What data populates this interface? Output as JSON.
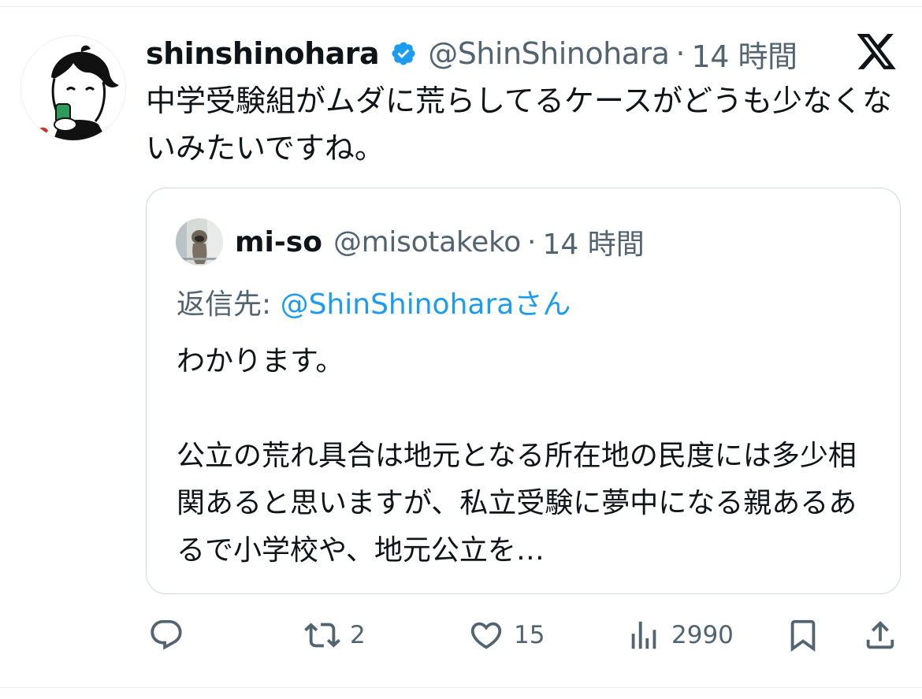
{
  "tweet": {
    "display_name": "shinshinohara",
    "verified": true,
    "handle": "@ShinShinohara",
    "separator": "·",
    "time": "14 時間",
    "text": "中学受験組がムダに荒らしてるケースがどうも少なくないみたいですね。"
  },
  "quote": {
    "display_name": "mi-so",
    "handle": "@misotakeko",
    "separator": "·",
    "time": "14 時間",
    "reply_prefix": "返信先: ",
    "reply_mention": "@ShinShinohara",
    "reply_suffix": "さん",
    "paragraph_1": "わかります。",
    "paragraph_2": "公立の荒れ具合は地元となる所在地の民度には多少相関あると思いますが、私立受験に夢中になる親あるあるで小学校や、地元公立を…"
  },
  "actions": {
    "reply_count": "",
    "retweet_count": "2",
    "like_count": "15",
    "views_count": "2990"
  },
  "icons": {
    "platform": "x-logo-icon",
    "verified": "verified-badge-icon",
    "reply": "reply-icon",
    "retweet": "retweet-icon",
    "like": "heart-icon",
    "views": "views-icon",
    "bookmark": "bookmark-icon",
    "share": "share-icon"
  },
  "colors": {
    "accent": "#1d9bf0",
    "secondary_text": "#536471",
    "primary_text": "#0f1419",
    "border": "#cfd9de"
  }
}
